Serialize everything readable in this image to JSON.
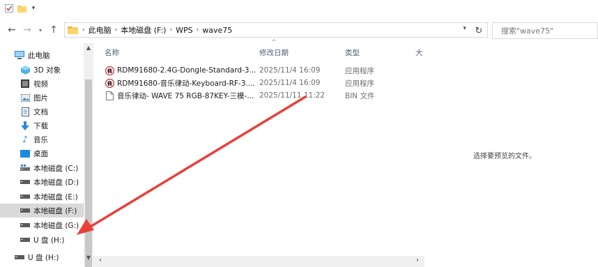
{
  "quick_access": {
    "dropdown_glyph": "▾"
  },
  "nav": {
    "back": "←",
    "forward": "→",
    "recent": "▾",
    "up": "↑",
    "refresh": "↻"
  },
  "breadcrumb": [
    {
      "label": "此电脑"
    },
    {
      "label": "本地磁盘 (F:)"
    },
    {
      "label": "WPS"
    },
    {
      "label": "wave75"
    }
  ],
  "search": {
    "placeholder": "搜索\"wave75\""
  },
  "sidebar": {
    "items": [
      {
        "label": "此电脑",
        "icon": "computer-icon"
      },
      {
        "label": "3D 对象",
        "icon": "3d-objects-icon"
      },
      {
        "label": "视频",
        "icon": "video-icon"
      },
      {
        "label": "图片",
        "icon": "pictures-icon"
      },
      {
        "label": "文档",
        "icon": "documents-icon"
      },
      {
        "label": "下载",
        "icon": "downloads-icon"
      },
      {
        "label": "音乐",
        "icon": "music-icon"
      },
      {
        "label": "桌面",
        "icon": "desktop-icon"
      },
      {
        "label": "本地磁盘 (C:)",
        "icon": "system-drive-icon"
      },
      {
        "label": "本地磁盘 (D:)",
        "icon": "drive-icon"
      },
      {
        "label": "本地磁盘 (E:)",
        "icon": "drive-icon"
      },
      {
        "label": "本地磁盘 (F:)",
        "icon": "drive-icon",
        "selected": true
      },
      {
        "label": "本地磁盘 (G:)",
        "icon": "drive-icon"
      },
      {
        "label": "U 盘 (H:)",
        "icon": "usb-drive-icon"
      },
      {
        "label": "U 盘 (H:)",
        "icon": "usb-drive-icon"
      }
    ]
  },
  "columns": {
    "name": "名称",
    "date": "修改日期",
    "type": "类型",
    "size": "大"
  },
  "files": [
    {
      "name": "RDM91680-2.4G-Dongle-Standard-3....",
      "date": "2025/11/4 16:09",
      "type": "应用程序",
      "icon": "app-icon"
    },
    {
      "name": "RDM91680-音乐律动-Keyboard-RF-3....",
      "date": "2025/11/4 16:09",
      "type": "应用程序",
      "icon": "app-icon"
    },
    {
      "name": "音乐律动- WAVE 75 RGB-87KEY-三模-...",
      "date": "2025/11/11 11:22",
      "type": "BIN 文件",
      "icon": "file-icon"
    }
  ],
  "preview": {
    "text": "选择要预览的文件。"
  },
  "colors": {
    "accent": "#0078d7",
    "folder": "#f8c64c",
    "arrow": "#e8413a",
    "selected_bg": "#d9d9d9"
  }
}
